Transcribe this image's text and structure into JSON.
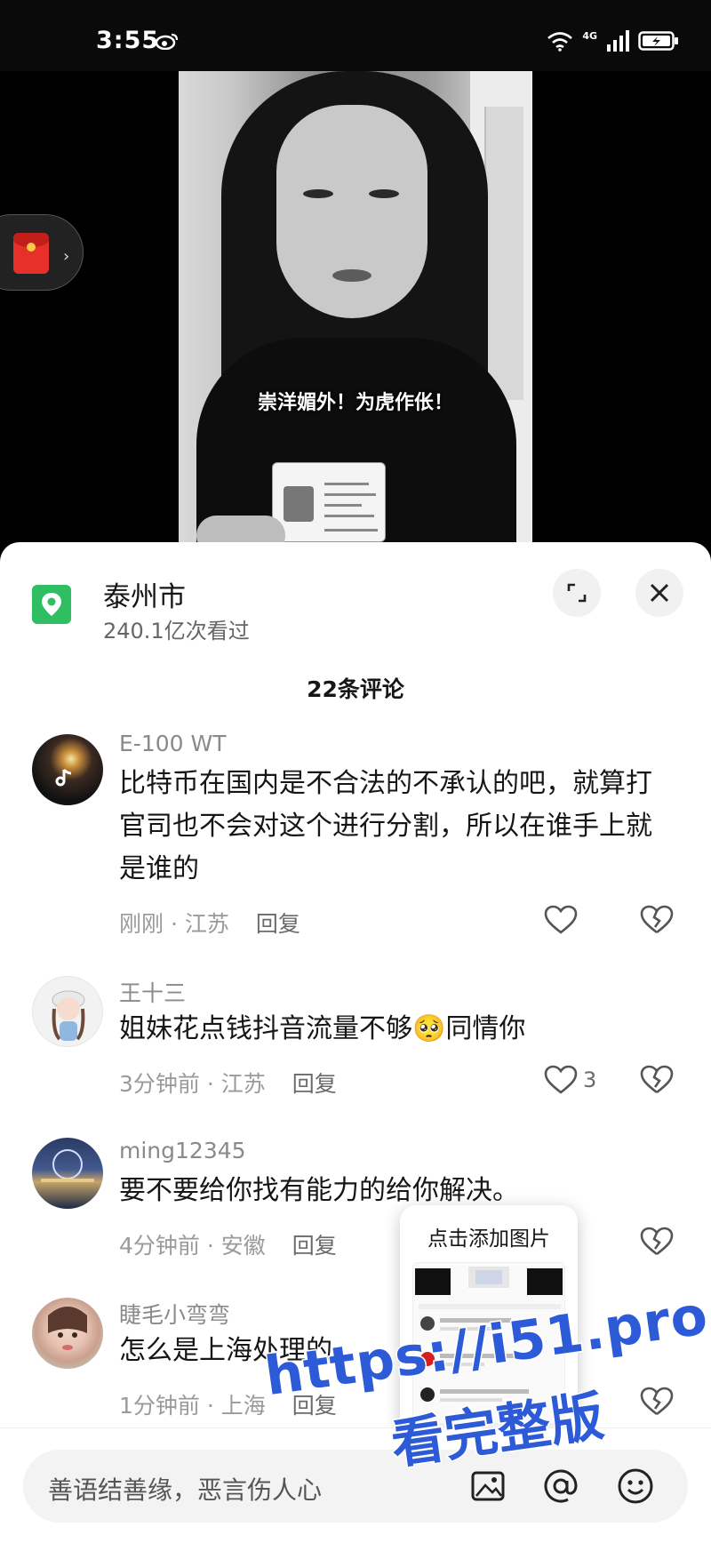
{
  "status_bar": {
    "time": "3:55",
    "network": "4G"
  },
  "video": {
    "caption": "崇洋媚外！为虎作伥！"
  },
  "location": {
    "title": "泰州市",
    "views": "240.1亿次看过"
  },
  "comments_header": "22条评论",
  "comments": [
    {
      "user": "E-100 WT",
      "text": "比特币在国内是不合法的不承认的吧，就算打官司也不会对这个进行分割，所以在谁手上就是谁的",
      "time_loc": "刚刚 · 江苏",
      "reply": "回复",
      "likes": ""
    },
    {
      "user": "王十三",
      "text": "姐妹花点钱抖音流量不够🥺同情你",
      "time_loc": "3分钟前 · 江苏",
      "reply": "回复",
      "likes": "3"
    },
    {
      "user": "ming12345",
      "text": "要不要给你找有能力的给你解决。",
      "time_loc": "4分钟前 · 安徽",
      "reply": "回复",
      "likes": ""
    },
    {
      "user": "睫毛小弯弯",
      "text": "怎么是上海处理的",
      "time_loc": "1分钟前 · 上海",
      "reply": "回复",
      "likes": ""
    }
  ],
  "image_popup": {
    "title": "点击添加图片"
  },
  "input": {
    "placeholder": "善语结善缘，恶言伤人心"
  },
  "watermark": {
    "line1": "https://i51.pro",
    "line2": "看完整版"
  },
  "colors": {
    "accent_green": "#2fbf62",
    "watermark_blue": "#2d5bd8"
  }
}
